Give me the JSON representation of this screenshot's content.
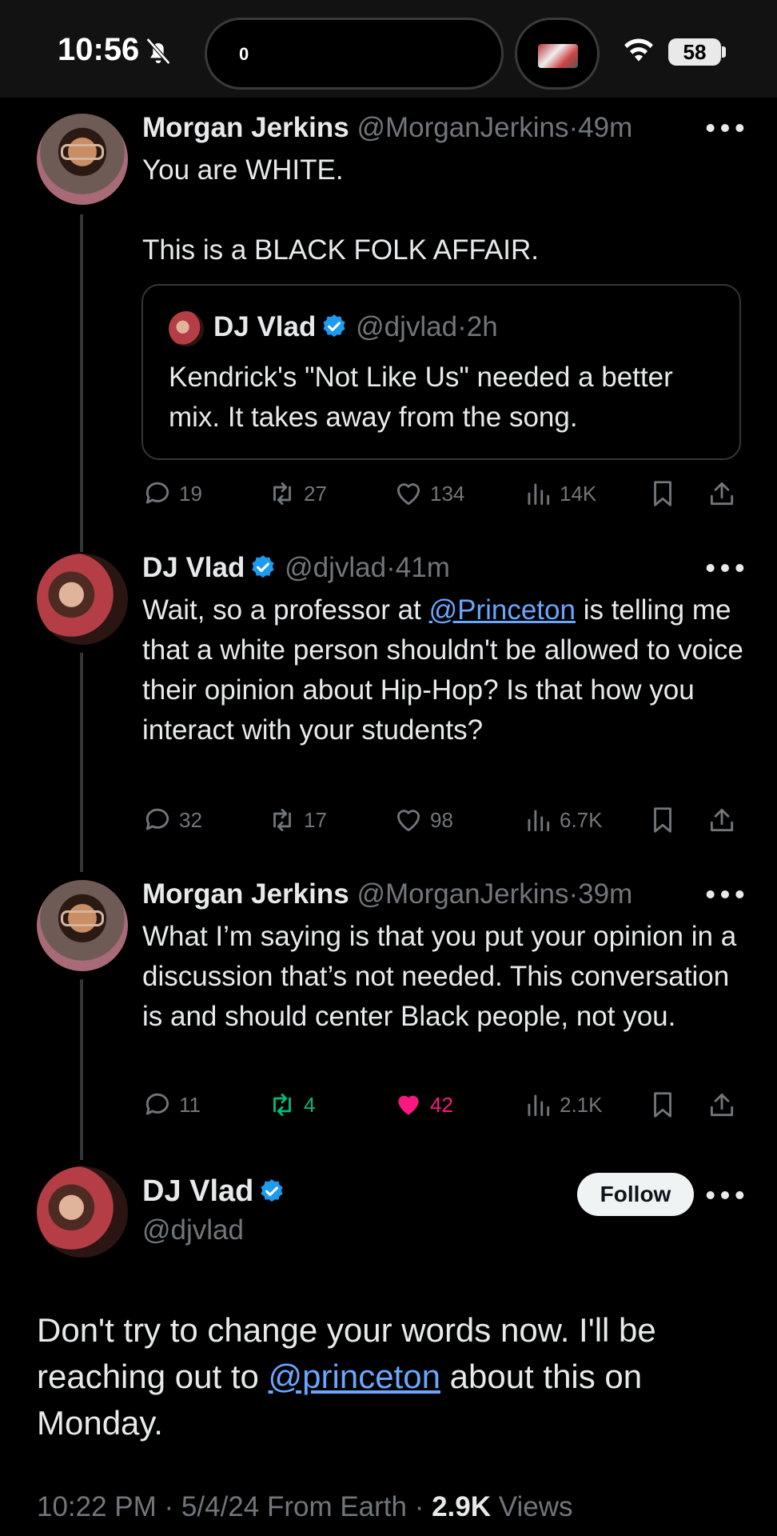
{
  "status_bar": {
    "time": "10:56",
    "island_label": "0",
    "battery": "58",
    "icons": [
      "bell-slash-icon",
      "wifi-icon",
      "battery-icon"
    ]
  },
  "tweets": [
    {
      "name": "Morgan Jerkins",
      "handle": "@MorganJerkins",
      "time": "49m",
      "text_line1": "You are WHITE.",
      "text_line2": "This is a BLACK FOLK AFFAIR.",
      "quote": {
        "name": "DJ Vlad",
        "handle": "@djvlad",
        "time": "2h",
        "text": "Kendrick's \"Not Like Us\" needed a better mix.  It takes away from the song."
      },
      "replies": "19",
      "retweets": "27",
      "likes": "134",
      "views": "14K"
    },
    {
      "name": "DJ Vlad",
      "handle": "@djvlad",
      "time": "41m",
      "text_before": "Wait, so a professor at ",
      "mention": "@Princeton",
      "text_after": " is telling me that a white person shouldn't be allowed to voice their opinion about Hip-Hop?  Is that how you interact with your students?",
      "replies": "32",
      "retweets": "17",
      "likes": "98",
      "views": "6.7K"
    },
    {
      "name": "Morgan Jerkins",
      "handle": "@MorganJerkins",
      "time": "39m",
      "text": "What I’m saying is that you put your opinion in a discussion that’s not needed. This conversation is and should center Black people, not you.",
      "replies": "11",
      "retweets": "4",
      "likes": "42",
      "views": "2.1K",
      "liked": true,
      "retweeted": true
    }
  ],
  "main_tweet": {
    "name": "DJ Vlad",
    "handle": "@djvlad",
    "follow_label": "Follow",
    "text_before": "Don't try to change your words now.  I'll be reaching out to ",
    "mention": "@princeton",
    "text_after": " about this on Monday.",
    "meta_time": "10:22 PM · 5/4/24 From Earth · ",
    "meta_views_count": "2.9K",
    "meta_views_label": " Views"
  },
  "colors": {
    "background": "#000000",
    "text": "#e7e9ea",
    "secondary": "#71767b",
    "link": "#6aa6ff",
    "verified": "#1d9bf0",
    "retweet_active": "#00ba7c",
    "like_active": "#f91880"
  }
}
